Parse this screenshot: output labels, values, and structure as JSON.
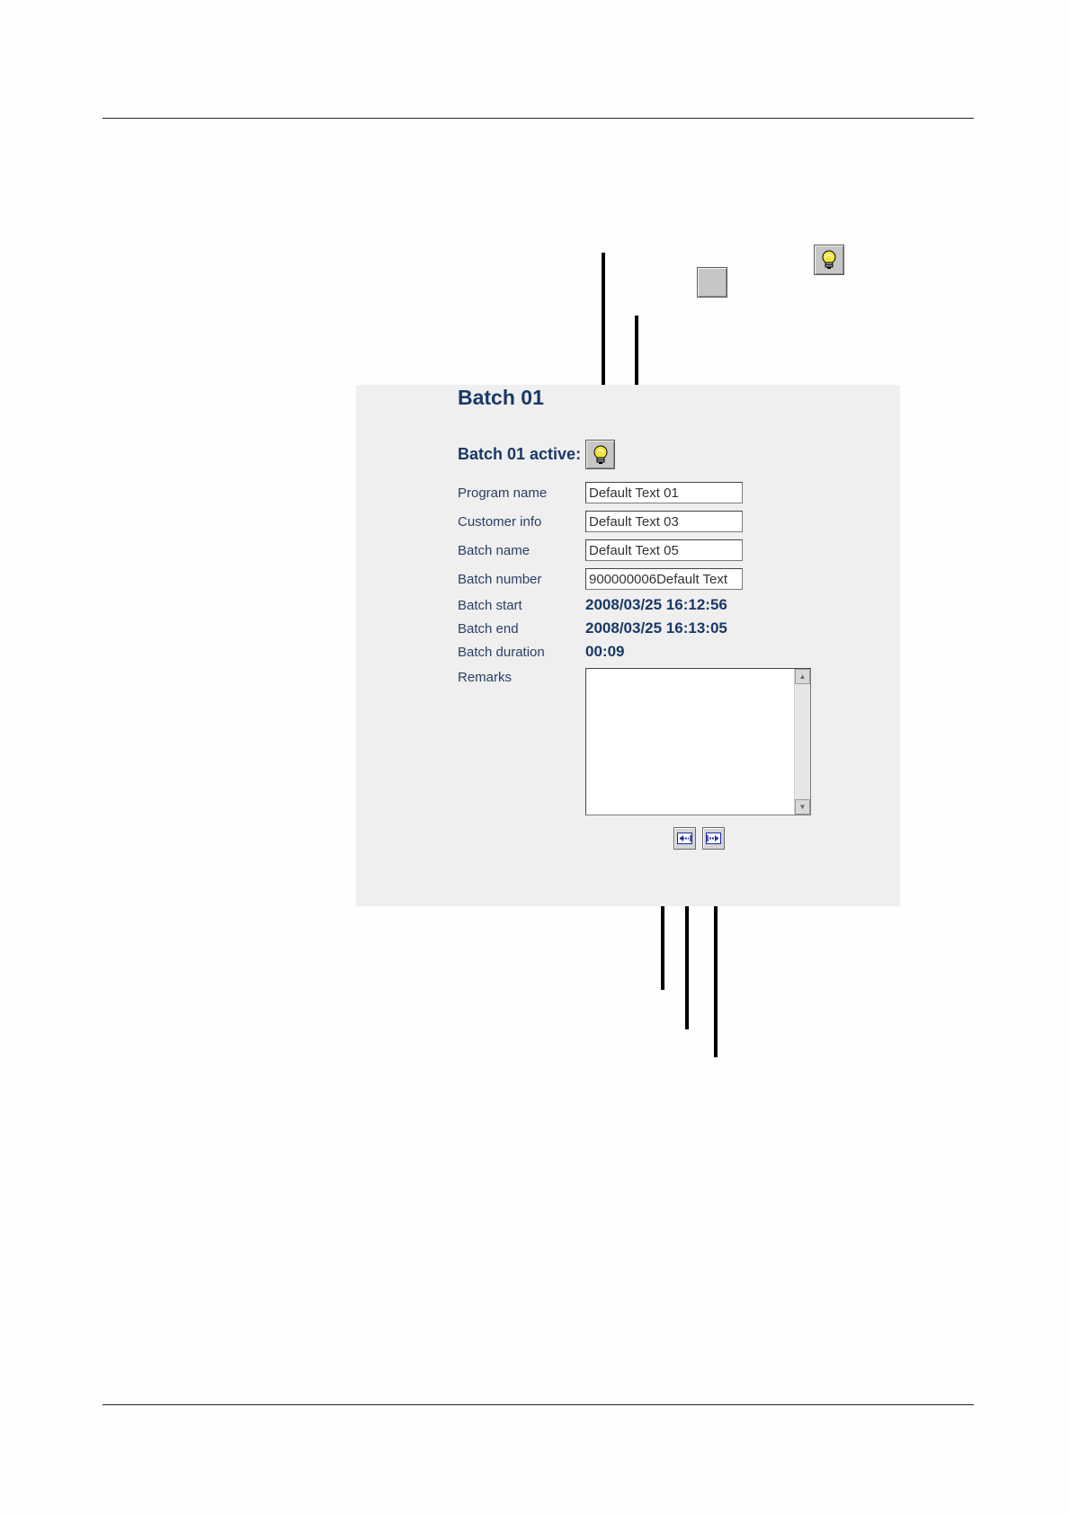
{
  "panel": {
    "title": "Batch 01",
    "active_label": "Batch 01 active:",
    "fields": {
      "program_name": {
        "label": "Program name",
        "value": "Default Text 01"
      },
      "customer_info": {
        "label": "Customer info",
        "value": "Default Text 03"
      },
      "batch_name": {
        "label": "Batch name",
        "value": "Default Text 05"
      },
      "batch_number": {
        "label": "Batch number",
        "value": "900000006Default Text"
      }
    },
    "readouts": {
      "batch_start": {
        "label": "Batch start",
        "value": "2008/03/25 16:12:56"
      },
      "batch_end": {
        "label": "Batch end",
        "value": "2008/03/25 16:13:05"
      },
      "batch_duration": {
        "label": "Batch duration",
        "value": "00:09"
      }
    },
    "remarks": {
      "label": "Remarks",
      "value": ""
    }
  },
  "icons": {
    "lamp": "lightbulb-icon",
    "previous": "arrow-left-icon",
    "next": "arrow-right-icon"
  },
  "colors": {
    "panel_background": "#efefef",
    "label_text": "#1a3866",
    "lamp_glow": "#f4e542"
  }
}
